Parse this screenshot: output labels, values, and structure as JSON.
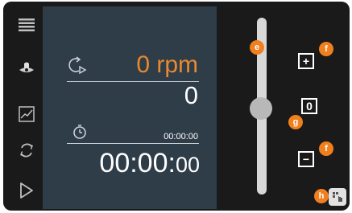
{
  "sidebar": {
    "items": [
      {
        "icon": "menu-icon"
      },
      {
        "icon": "stirrer-icon"
      },
      {
        "icon": "graph-icon"
      },
      {
        "icon": "rotation-icon"
      },
      {
        "icon": "play-icon"
      }
    ]
  },
  "display": {
    "speed_value": "0 rpm",
    "speed_setpoint": "0",
    "timer_small": "00:00:00",
    "timer_main": "00:00:",
    "timer_main_seconds": "00"
  },
  "controls": {
    "plus_label": "+",
    "zero_label": "0",
    "minus_label": "−"
  },
  "callouts": {
    "e": "e",
    "f_top": "f",
    "g": "g",
    "f_bottom": "f",
    "h": "h"
  },
  "colors": {
    "accent": "#e8892f",
    "panel": "#2f3d49",
    "callout": "#f07f1e"
  }
}
